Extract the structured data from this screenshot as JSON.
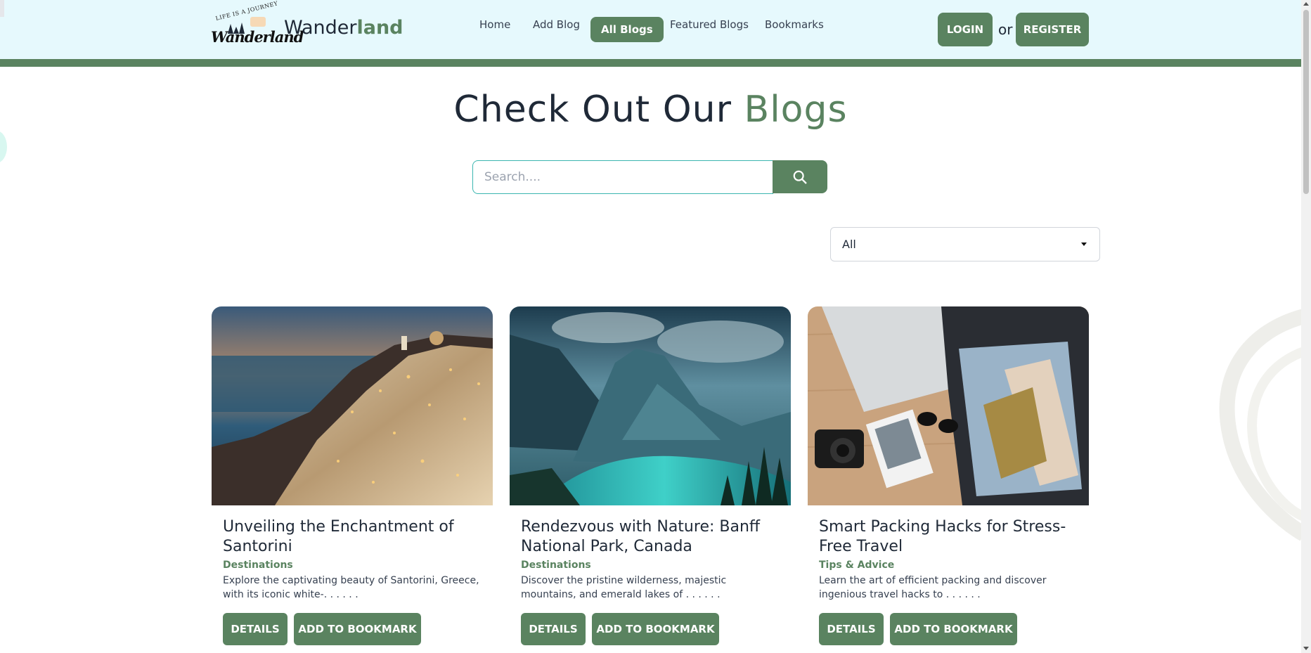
{
  "brand": {
    "logo_tagline": "LIFE IS A JOURNEY",
    "logo_script": "Wanderland",
    "name_main": "Wander",
    "name_accent": "land"
  },
  "nav": {
    "items": [
      {
        "label": "Home"
      },
      {
        "label": "Add Blog"
      },
      {
        "label": "All Blogs",
        "active": true
      },
      {
        "label": "Featured Blogs"
      },
      {
        "label": "Bookmarks"
      }
    ]
  },
  "auth": {
    "login_label": "LOGIN",
    "or_text": "or",
    "register_label": "REGISTER"
  },
  "heading": {
    "main": "Check Out Our ",
    "accent": "Blogs"
  },
  "search": {
    "placeholder": "Search....",
    "icon": "search-icon"
  },
  "filter": {
    "selected": "All"
  },
  "blogs": [
    {
      "title": "Unveiling the Enchantment of Santorini",
      "category": "Destinations",
      "description": "Explore the captivating beauty of Santorini, Greece, with its iconic white-. . . . . .",
      "details_label": "DETAILS",
      "bookmark_label": "ADD TO BOOKMARK"
    },
    {
      "title": "Rendezvous with Nature: Banff National Park, Canada",
      "category": "Destinations",
      "description": "Discover the pristine wilderness, majestic mountains, and emerald lakes of . . . . . .",
      "details_label": "DETAILS",
      "bookmark_label": "ADD TO BOOKMARK"
    },
    {
      "title": "Smart Packing Hacks for Stress-Free Travel",
      "category": "Tips & Advice",
      "description": "Learn the art of efficient packing and discover ingenious travel hacks to . . . . . .",
      "details_label": "DETAILS",
      "bookmark_label": "ADD TO BOOKMARK"
    }
  ],
  "colors": {
    "accent": "#5a8360",
    "navbar_bg": "#e6f9fd",
    "search_border": "#3bb6b0",
    "text": "#1f2937"
  }
}
